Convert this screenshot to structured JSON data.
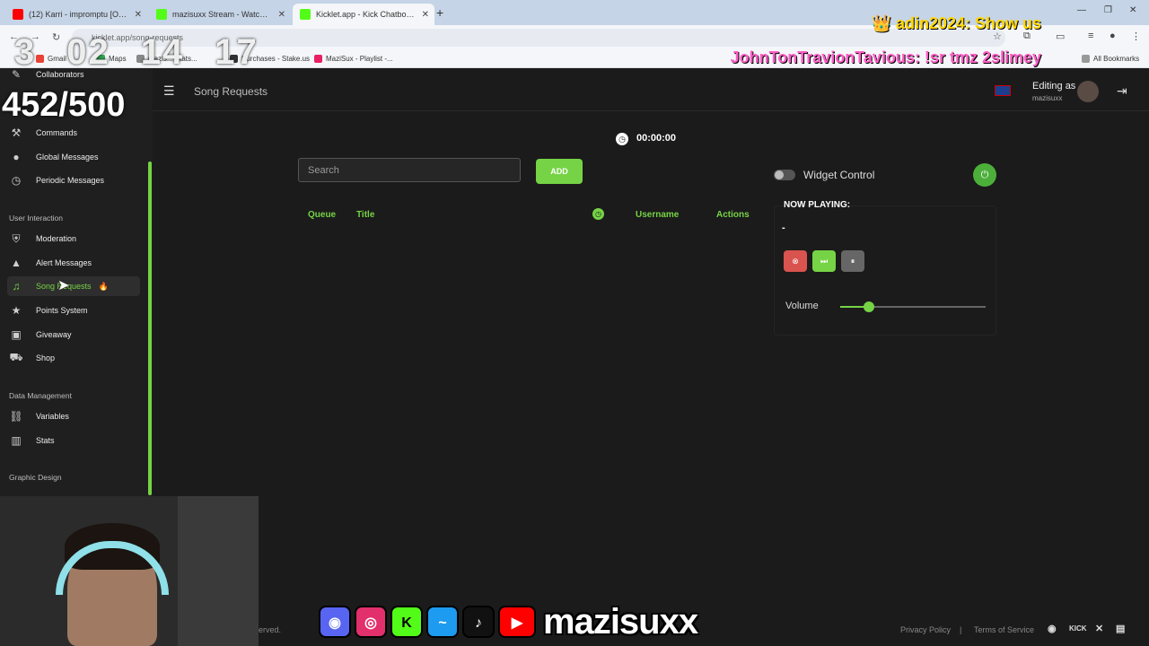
{
  "browser": {
    "tabs": [
      {
        "label": "(12) Karri - impromptu [Official",
        "color": "#ff0000"
      },
      {
        "label": "mazisuxx Stream - Watch Live o",
        "color": "#53fc18"
      },
      {
        "label": "Kicklet.app - Kick Chatbot and",
        "color": "#53fc18"
      }
    ],
    "url": "kicklet.app/song-requests",
    "bookmarks": [
      "Gmail",
      "Maps",
      "mazis... Stats...",
      "Purchases - Stake.us",
      "MaziSux - Playlist -..."
    ],
    "all_bookmarks": "All Bookmarks"
  },
  "overlay": {
    "timer": [
      "3",
      "02",
      "14",
      "17"
    ],
    "goal": "452/500",
    "chat1": "adin2024: Show us",
    "chat2": "JohnTonTravionTavious: !sr tmz 2slimey"
  },
  "sidebar": {
    "top_item": "Collaborators",
    "items_a": [
      {
        "label": "Commands",
        "icon": "wrench-icon"
      },
      {
        "label": "Global Messages",
        "icon": "chat-icon"
      },
      {
        "label": "Periodic Messages",
        "icon": "clock-icon"
      }
    ],
    "section_user": "User Interaction",
    "items_b": [
      {
        "label": "Moderation",
        "icon": "shield-icon"
      },
      {
        "label": "Alert Messages",
        "icon": "alert-icon"
      },
      {
        "label": "Song Requests",
        "icon": "music-icon"
      },
      {
        "label": "Points System",
        "icon": "star-icon"
      },
      {
        "label": "Giveaway",
        "icon": "gift-icon"
      },
      {
        "label": "Shop",
        "icon": "cart-icon"
      }
    ],
    "section_data": "Data Management",
    "items_c": [
      {
        "label": "Variables",
        "icon": "link-icon"
      },
      {
        "label": "Stats",
        "icon": "chart-icon"
      }
    ],
    "section_graphic": "Graphic Design"
  },
  "header": {
    "page_title": "Song Requests",
    "editing_as": "Editing as",
    "username": "mazisuxx"
  },
  "player": {
    "elapsed": "00:00:00",
    "search_placeholder": "Search",
    "add_label": "ADD",
    "columns": {
      "queue": "Queue",
      "title": "Title",
      "username": "Username",
      "actions": "Actions"
    },
    "widget_control": "Widget Control",
    "widget_enabled": false,
    "now_playing_title": "NOW PLAYING:",
    "now_playing_song": "-",
    "volume_label": "Volume",
    "volume": 0.2,
    "accent": "#76d345"
  },
  "footer": {
    "copyright": "erved.",
    "privacy": "Privacy Policy",
    "sep": "|",
    "terms": "Terms of Service",
    "kick": "KICK"
  },
  "stream_brand": "mazisuxx"
}
